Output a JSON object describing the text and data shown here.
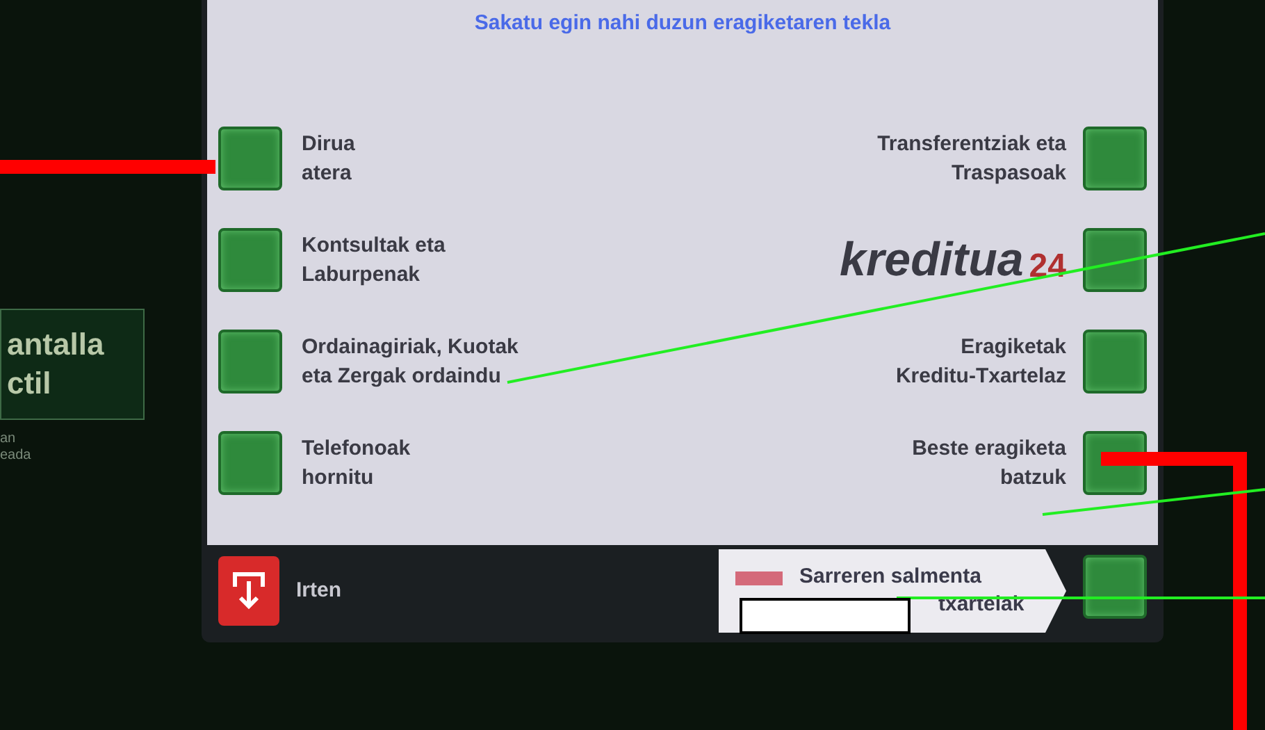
{
  "prompt": "Sakatu egin nahi duzun eragiketaren tekla",
  "side_sign": {
    "lines": [
      "antalla",
      "ctil"
    ],
    "small": [
      "an",
      "eada"
    ]
  },
  "left_options": [
    {
      "lines": [
        "Dirua",
        "atera"
      ]
    },
    {
      "lines": [
        "Kontsultak eta",
        "Laburpenak"
      ]
    },
    {
      "lines": [
        "Ordainagiriak, Kuotak",
        "eta Zergak ordaindu"
      ]
    },
    {
      "lines": [
        "Telefonoak",
        "hornitu"
      ]
    }
  ],
  "right_options": [
    {
      "kind": "text",
      "lines": [
        "Transferentziak eta",
        "Traspasoak"
      ]
    },
    {
      "kind": "logo",
      "word": "kreditua",
      "number": "24"
    },
    {
      "kind": "text",
      "lines": [
        "Eragiketak",
        "Kreditu-Txartelaz"
      ]
    },
    {
      "kind": "text",
      "lines": [
        "Beste eragiketa",
        "batzuk"
      ]
    }
  ],
  "exit": {
    "label": "Irten"
  },
  "promo": {
    "lines": [
      "Sarreren salmenta",
      "txartelak"
    ]
  }
}
